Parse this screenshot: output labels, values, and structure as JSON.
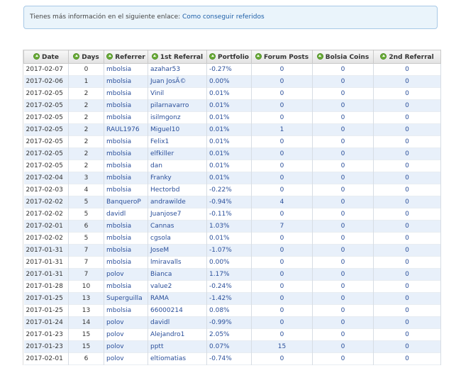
{
  "info": {
    "text": "Tienes más información en el siguiente enlace: ",
    "link": "Como conseguir referidos"
  },
  "table": {
    "headers": [
      "Date",
      "Days",
      "Referrer",
      "1st Referral",
      "Portfolio",
      "Forum Posts",
      "Bolsia Coins",
      "2nd Referral"
    ],
    "rows": [
      [
        "2017-02-07",
        "0",
        "mbolsia",
        "azahar53",
        "-0.27%",
        "0",
        "0",
        "0"
      ],
      [
        "2017-02-06",
        "1",
        "mbolsia",
        "Juan JosÃ©",
        "0.00%",
        "0",
        "0",
        "0"
      ],
      [
        "2017-02-05",
        "2",
        "mbolsia",
        "Vinil",
        "0.01%",
        "0",
        "0",
        "0"
      ],
      [
        "2017-02-05",
        "2",
        "mbolsia",
        "pilarnavarro",
        "0.01%",
        "0",
        "0",
        "0"
      ],
      [
        "2017-02-05",
        "2",
        "mbolsia",
        "isilmgonz",
        "0.01%",
        "0",
        "0",
        "0"
      ],
      [
        "2017-02-05",
        "2",
        "RAUL1976",
        "Miguel10",
        "0.01%",
        "1",
        "0",
        "0"
      ],
      [
        "2017-02-05",
        "2",
        "mbolsia",
        "Felix1",
        "0.01%",
        "0",
        "0",
        "0"
      ],
      [
        "2017-02-05",
        "2",
        "mbolsia",
        "elfkiller",
        "0.01%",
        "0",
        "0",
        "0"
      ],
      [
        "2017-02-05",
        "2",
        "mbolsia",
        "dan",
        "0.01%",
        "0",
        "0",
        "0"
      ],
      [
        "2017-02-04",
        "3",
        "mbolsia",
        "Franky",
        "0.01%",
        "0",
        "0",
        "0"
      ],
      [
        "2017-02-03",
        "4",
        "mbolsia",
        "Hectorbd",
        "-0.22%",
        "0",
        "0",
        "0"
      ],
      [
        "2017-02-02",
        "5",
        "BanqueroP",
        "andrawilde",
        "-0.94%",
        "4",
        "0",
        "0"
      ],
      [
        "2017-02-02",
        "5",
        "davidl",
        "Juanjose7",
        "-0.11%",
        "0",
        "0",
        "0"
      ],
      [
        "2017-02-01",
        "6",
        "mbolsia",
        "Cannas",
        "1.03%",
        "7",
        "0",
        "0"
      ],
      [
        "2017-02-02",
        "5",
        "mbolsia",
        "cgsola",
        "0.01%",
        "0",
        "0",
        "0"
      ],
      [
        "2017-01-31",
        "7",
        "mbolsia",
        "JoseM",
        "-1.07%",
        "0",
        "0",
        "0"
      ],
      [
        "2017-01-31",
        "7",
        "mbolsia",
        "lmiravalls",
        "0.00%",
        "0",
        "0",
        "0"
      ],
      [
        "2017-01-31",
        "7",
        "polov",
        "Bianca",
        "1.17%",
        "0",
        "0",
        "0"
      ],
      [
        "2017-01-28",
        "10",
        "mbolsia",
        "value2",
        "-0.24%",
        "0",
        "0",
        "0"
      ],
      [
        "2017-01-25",
        "13",
        "Superguilla",
        "RAMA",
        "-1.42%",
        "0",
        "0",
        "0"
      ],
      [
        "2017-01-25",
        "13",
        "mbolsia",
        "66000214",
        "0.08%",
        "0",
        "0",
        "0"
      ],
      [
        "2017-01-24",
        "14",
        "polov",
        "davidl",
        "-0.99%",
        "0",
        "0",
        "0"
      ],
      [
        "2017-01-23",
        "15",
        "polov",
        "Alejandro1",
        "2.05%",
        "0",
        "0",
        "0"
      ],
      [
        "2017-01-23",
        "15",
        "polov",
        "pptt",
        "0.07%",
        "15",
        "0",
        "0"
      ],
      [
        "2017-02-01",
        "6",
        "polov",
        "eltiomatias",
        "-0.74%",
        "0",
        "0",
        "0"
      ]
    ]
  }
}
